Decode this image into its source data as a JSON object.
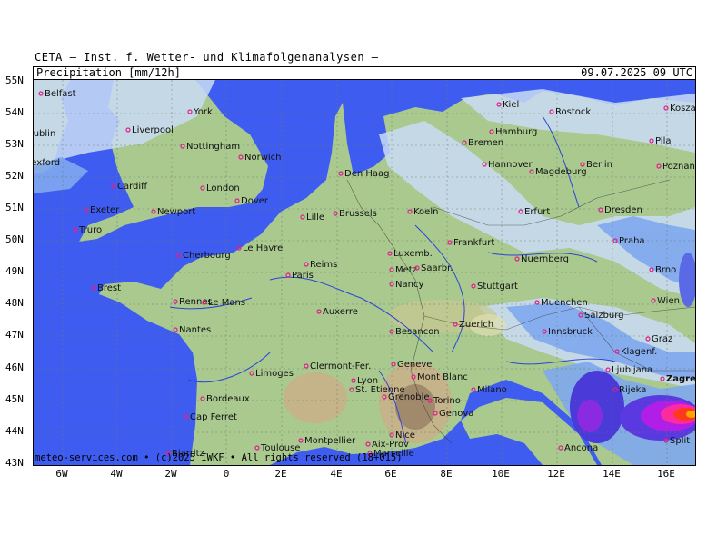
{
  "header": {
    "institute": "CETA — Inst. f. Wetter- und Klimafolgenanalysen —"
  },
  "titlebar": {
    "field": "Precipitation [mm/12h]",
    "datetime": "09.07.2025 09 UTC"
  },
  "footer": {
    "text": "meteo-services.com • (c)2025 IWKF • All rights reserved (18+015)"
  },
  "axes": {
    "lat_labels": [
      "55N",
      "54N",
      "53N",
      "52N",
      "51N",
      "50N",
      "49N",
      "48N",
      "47N",
      "46N",
      "45N",
      "44N",
      "43N"
    ],
    "lon_labels": [
      "6W",
      "4W",
      "2W",
      "0",
      "2E",
      "4E",
      "6E",
      "8E",
      "10E",
      "12E",
      "14E",
      "16E"
    ]
  },
  "cities": [
    {
      "name": "Belfast"
    },
    {
      "name": "Dublin"
    },
    {
      "name": "Wexford"
    },
    {
      "name": "Liverpool"
    },
    {
      "name": "York"
    },
    {
      "name": "Nottingham"
    },
    {
      "name": "Norwich"
    },
    {
      "name": "Cardiff"
    },
    {
      "name": "London"
    },
    {
      "name": "Dover"
    },
    {
      "name": "Exeter"
    },
    {
      "name": "Newport"
    },
    {
      "name": "Truro"
    },
    {
      "name": "Le Havre"
    },
    {
      "name": "Cherbourg"
    },
    {
      "name": "Brest"
    },
    {
      "name": "Rennes"
    },
    {
      "name": "Le Mans"
    },
    {
      "name": "Nantes"
    },
    {
      "name": "Paris"
    },
    {
      "name": "Reims"
    },
    {
      "name": "Lille"
    },
    {
      "name": "Brussels"
    },
    {
      "name": "Den Haag"
    },
    {
      "name": "Koeln"
    },
    {
      "name": "Luxemb."
    },
    {
      "name": "Metz"
    },
    {
      "name": "Saarbr."
    },
    {
      "name": "Nancy"
    },
    {
      "name": "Auxerre"
    },
    {
      "name": "Besancon"
    },
    {
      "name": "Limoges"
    },
    {
      "name": "Clermont-Fer."
    },
    {
      "name": "Lyon"
    },
    {
      "name": "Geneve"
    },
    {
      "name": "Mont Blanc"
    },
    {
      "name": "St. Etienne"
    },
    {
      "name": "Grenoble"
    },
    {
      "name": "Bordeaux"
    },
    {
      "name": "Cap Ferret"
    },
    {
      "name": "Toulouse"
    },
    {
      "name": "Biarritz"
    },
    {
      "name": "Montpellier"
    },
    {
      "name": "Aix-Prov"
    },
    {
      "name": "Marseille"
    },
    {
      "name": "Nice"
    },
    {
      "name": "Torino"
    },
    {
      "name": "Genova"
    },
    {
      "name": "Milano"
    },
    {
      "name": "Zuerich"
    },
    {
      "name": "Stuttgart"
    },
    {
      "name": "Frankfurt"
    },
    {
      "name": "Nuernberg"
    },
    {
      "name": "Erfurt"
    },
    {
      "name": "Hannover"
    },
    {
      "name": "Magdeburg"
    },
    {
      "name": "Berlin"
    },
    {
      "name": "Bremen"
    },
    {
      "name": "Hamburg"
    },
    {
      "name": "Kiel"
    },
    {
      "name": "Rostock"
    },
    {
      "name": "Koszalin"
    },
    {
      "name": "Pila"
    },
    {
      "name": "Poznan"
    },
    {
      "name": "Dresden"
    },
    {
      "name": "Praha"
    },
    {
      "name": "Brno"
    },
    {
      "name": "Wien"
    },
    {
      "name": "Muenchen"
    },
    {
      "name": "Salzburg"
    },
    {
      "name": "Innsbruck"
    },
    {
      "name": "Graz"
    },
    {
      "name": "Klagenf."
    },
    {
      "name": "Ljubljana"
    },
    {
      "name": "Zagreb"
    },
    {
      "name": "Rijeka"
    },
    {
      "name": "Split"
    },
    {
      "name": "Ancona"
    }
  ],
  "colors": {
    "sea": "#3f5cf0",
    "land": "#a9c98f",
    "rain_light": "#c9dcf5",
    "rain_mod": "#7fa8ee",
    "rain_heavy": "#8a2be2",
    "rain_extreme": "#ff3a1a"
  }
}
